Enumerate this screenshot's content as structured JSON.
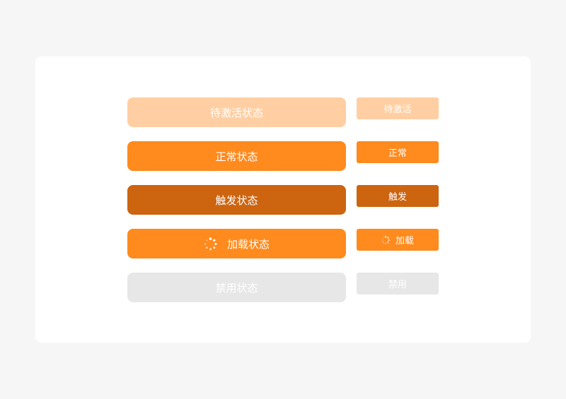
{
  "colors": {
    "page_background": "#f6f6f6",
    "card_background": "#ffffff",
    "pending": "#ffcfa3",
    "normal": "#ff8a1d",
    "pressed": "#cc6410",
    "loading": "#ff8a1d",
    "disabled": "#e7e7e7",
    "text": "#ffffff"
  },
  "buttons": {
    "large": {
      "pending": "待激活状态",
      "normal": "正常状态",
      "pressed": "触发状态",
      "loading": "加载状态",
      "disabled": "禁用状态"
    },
    "small": {
      "pending": "待激活",
      "normal": "正常",
      "pressed": "触发",
      "loading": "加载",
      "disabled": "禁用"
    }
  },
  "icons": {
    "loading": "loading-spinner-icon"
  }
}
